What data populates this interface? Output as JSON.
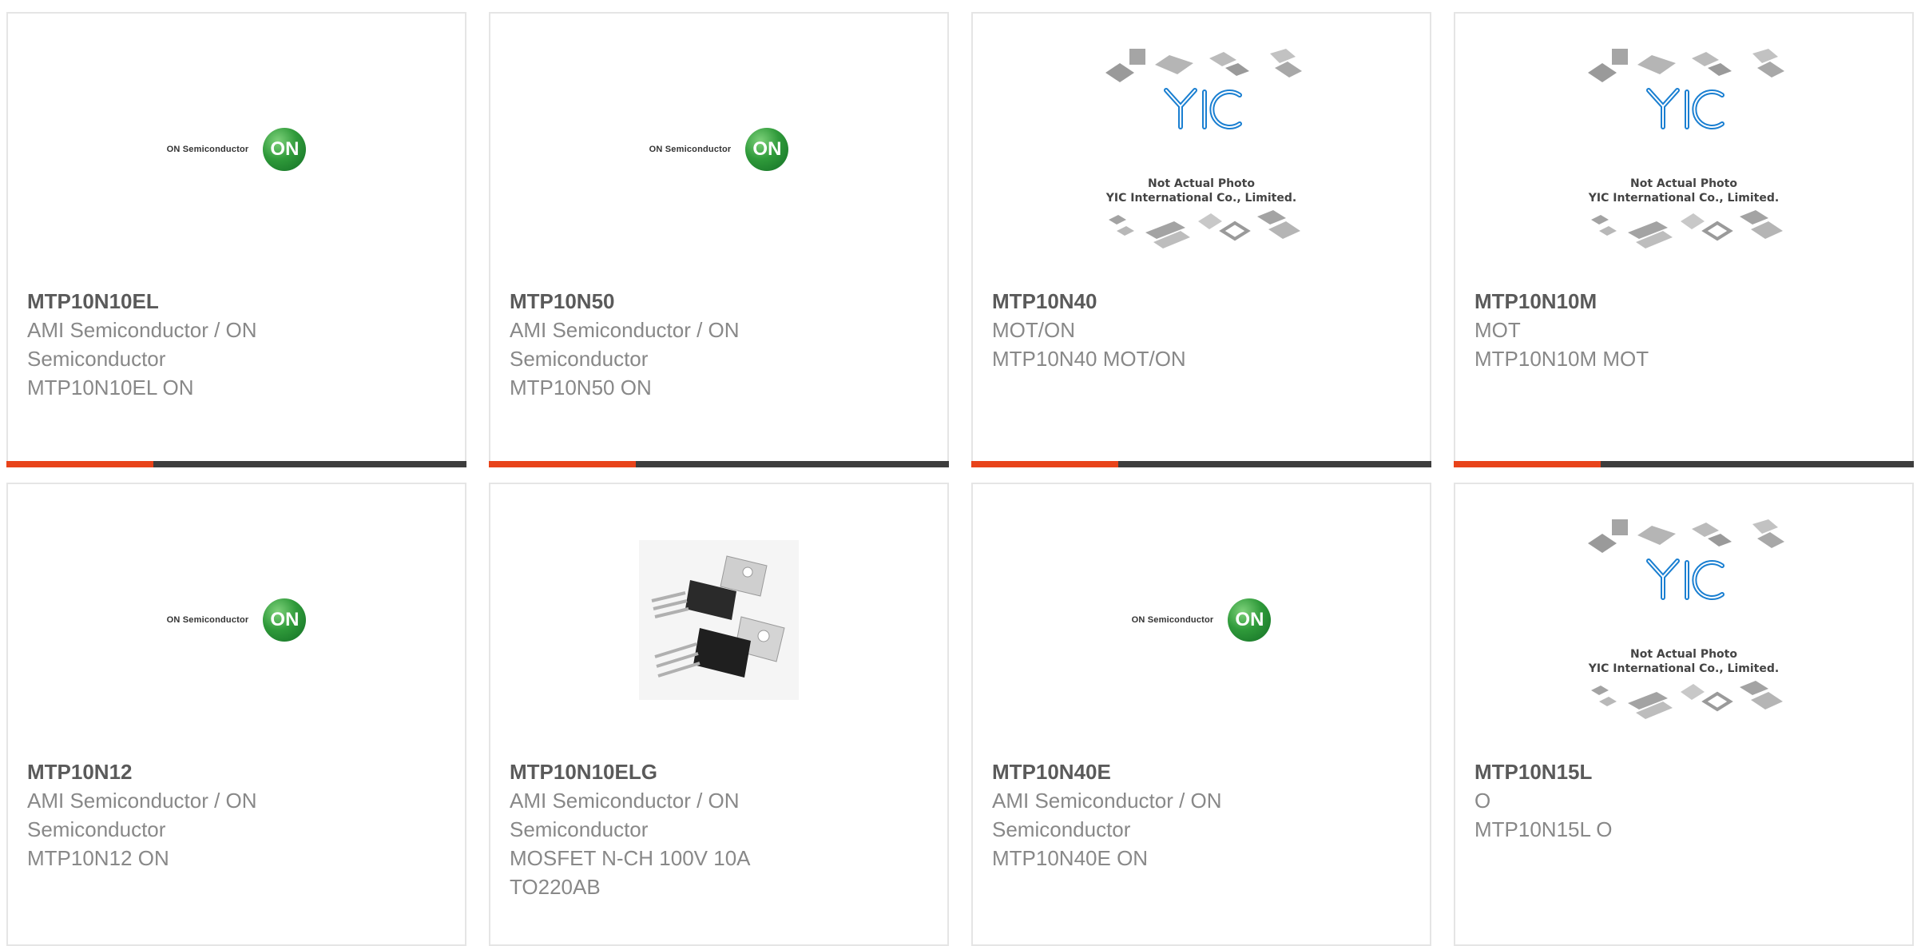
{
  "colors": {
    "accent_red": "#e8431a",
    "accent_dark": "#3d3d3d",
    "title": "#5a5a5a",
    "body": "#888888",
    "on_green": "#2f9a3a",
    "yic_blue": "#1a7fd1"
  },
  "products": [
    {
      "part": "MTP10N10EL",
      "lines": [
        "AMI Semiconductor / ON",
        "Semiconductor",
        "MTP10N10EL ON"
      ],
      "image": "on-semiconductor-logo",
      "logo_text": "ON Semiconductor",
      "logo_mark": "ON",
      "has_accent": true
    },
    {
      "part": "MTP10N50",
      "lines": [
        "AMI Semiconductor / ON",
        "Semiconductor",
        "MTP10N50 ON"
      ],
      "image": "on-semiconductor-logo",
      "logo_text": "ON Semiconductor",
      "logo_mark": "ON",
      "has_accent": true
    },
    {
      "part": "MTP10N40",
      "lines": [
        "MOT/ON",
        "MTP10N40 MOT/ON"
      ],
      "image": "yic-placeholder",
      "caption1": "Not Actual Photo",
      "caption2": "YIC International Co., Limited.",
      "has_accent": true
    },
    {
      "part": "MTP10N10M",
      "lines": [
        "MOT",
        "MTP10N10M MOT"
      ],
      "image": "yic-placeholder",
      "caption1": "Not Actual Photo",
      "caption2": "YIC International Co., Limited.",
      "has_accent": true
    },
    {
      "part": "MTP10N12",
      "lines": [
        "AMI Semiconductor / ON",
        "Semiconductor",
        "MTP10N12 ON"
      ],
      "image": "on-semiconductor-logo",
      "logo_text": "ON Semiconductor",
      "logo_mark": "ON",
      "has_accent": false
    },
    {
      "part": "MTP10N10ELG",
      "lines": [
        "AMI Semiconductor / ON",
        "Semiconductor",
        "MOSFET N-CH 100V 10A",
        "TO220AB"
      ],
      "image": "to220-transistor-photo",
      "has_accent": false
    },
    {
      "part": "MTP10N40E",
      "lines": [
        "AMI Semiconductor / ON",
        "Semiconductor",
        "MTP10N40E ON"
      ],
      "image": "on-semiconductor-logo",
      "logo_text": "ON Semiconductor",
      "logo_mark": "ON",
      "has_accent": false
    },
    {
      "part": "MTP10N15L",
      "lines": [
        "O",
        "MTP10N15L O"
      ],
      "image": "yic-placeholder",
      "caption1": "Not Actual Photo",
      "caption2": "YIC International Co., Limited.",
      "has_accent": false
    }
  ]
}
